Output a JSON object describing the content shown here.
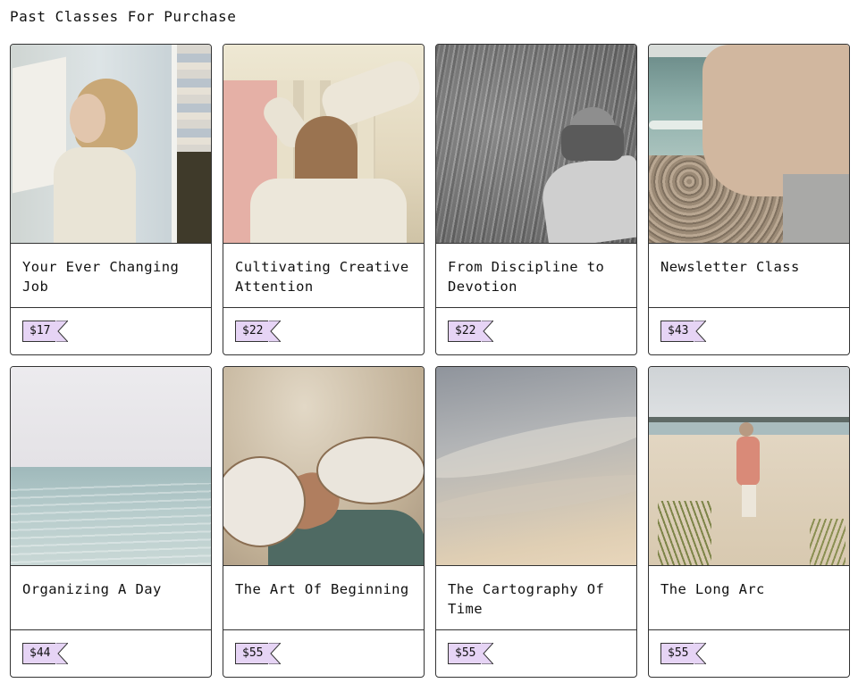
{
  "page": {
    "title": "Past Classes For Purchase"
  },
  "classes": [
    {
      "title": "Your Ever Changing Job",
      "price": "$17",
      "image": "woman-with-fabric-photo"
    },
    {
      "title": "Cultivating Creative Attention",
      "price": "$22",
      "image": "woman-arms-raised-photo"
    },
    {
      "title": "From Discipline to Devotion",
      "price": "$22",
      "image": "person-in-grass-bw-photo"
    },
    {
      "title": "Newsletter Class",
      "price": "$43",
      "image": "rocky-beach-sweater-photo"
    },
    {
      "title": "Organizing A Day",
      "price": "$44",
      "image": "ocean-horizon-photo"
    },
    {
      "title": "The Art Of Beginning",
      "price": "$55",
      "image": "sand-mirrors-photo"
    },
    {
      "title": "The Cartography Of Time",
      "price": "$55",
      "image": "cloudy-sky-photo"
    },
    {
      "title": "The Long Arc",
      "price": "$55",
      "image": "beach-walker-photo"
    }
  ],
  "colors": {
    "tag_fill": "#e6d4f5",
    "border": "#333333"
  }
}
